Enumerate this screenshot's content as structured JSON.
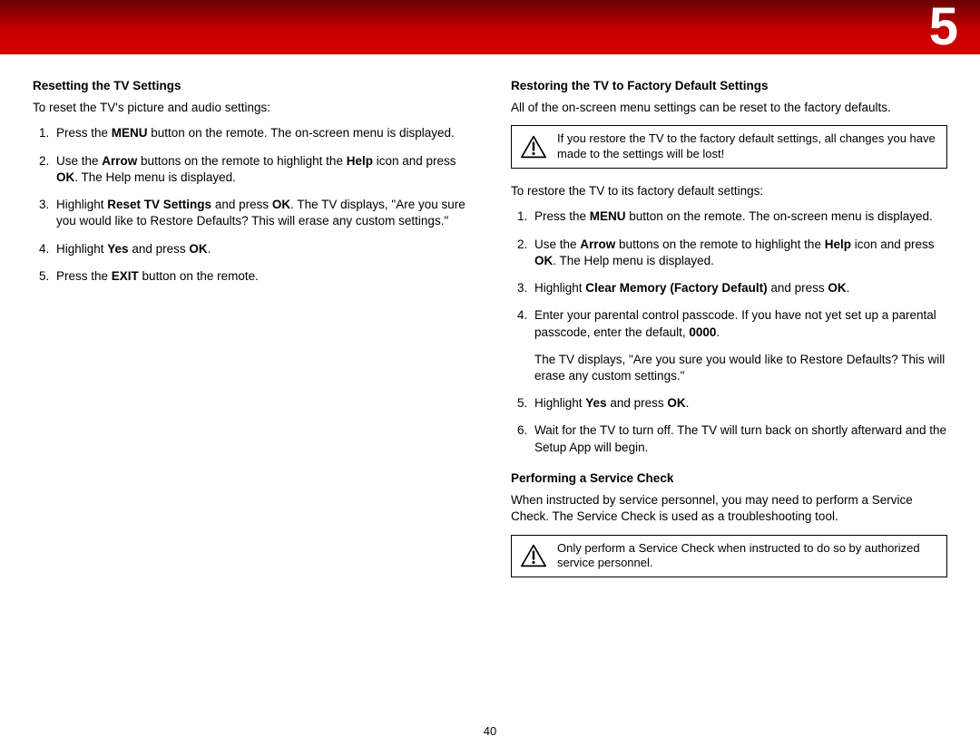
{
  "header": {
    "chapter": "5"
  },
  "left": {
    "title": "Resetting the TV Settings",
    "intro": "To reset the TV's picture and audio settings:",
    "steps": [
      "Press the <b>MENU</b> button on the remote. The on-screen menu is displayed.",
      "Use the <b>Arrow</b> buttons on the remote to highlight the <b>Help</b> icon and press <b>OK</b>. The Help menu is displayed.",
      "Highlight <b>Reset TV Settings</b> and press <b>OK</b>. The TV displays, \"Are you sure you would like to Restore Defaults? This will erase any custom settings.\"",
      "Highlight <b>Yes</b> and press <b>OK</b>.",
      "Press the <b>EXIT</b> button on the remote."
    ]
  },
  "right": {
    "title": "Restoring the TV to Factory Default Settings",
    "intro": "All of the on-screen menu settings can be reset to the factory defaults.",
    "warning1": "If you restore the TV to the factory default settings, all changes you have made to the settings will be lost!",
    "intro2": "To restore the TV to its factory default settings:",
    "steps": [
      "Press the <b>MENU</b> button on the remote. The on-screen menu is displayed.",
      "Use the <b>Arrow</b> buttons on the remote to highlight the <b>Help</b> icon and press <b>OK</b>. The Help menu is displayed.",
      "Highlight <b>Clear Memory (Factory Default)</b> and press <b>OK</b>.",
      "Enter your parental control passcode. If you have not yet set up a parental passcode, enter the default, <b>0000</b>.<div class=\"sub\">The TV displays, \"Are you sure you would like to Restore Defaults? This will erase any custom settings.\"</div>",
      "Highlight <b>Yes</b> and press <b>OK</b>.",
      "Wait for the TV to turn off. The TV will turn back on shortly afterward and the Setup App will begin."
    ],
    "service_title": "Performing a Service Check",
    "service_intro": "When instructed by service personnel, you may need to perform a Service Check. The Service Check is used as a troubleshooting tool.",
    "warning2": "Only perform a Service Check when instructed to do so by authorized service personnel."
  },
  "page_number": "40"
}
